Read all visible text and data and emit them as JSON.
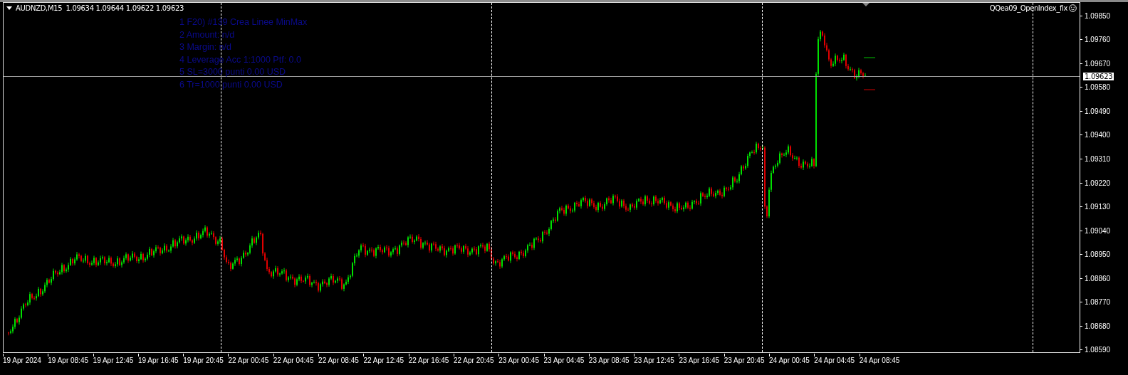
{
  "chart_header": {
    "symbol": "AUDNZD,M15",
    "ohlc": "1.09634 1.09644 1.09622 1.09623"
  },
  "indicator_lines": [
    "1 F20) #139 Crea Linee MinMax",
    "2 Amount: n/d",
    "3 Margin: n/d",
    "4 Leverage Acc 1:1000 Ptf: 0.0",
    "5 SL=3000 punti 0.00 USD",
    "6 Tr=1000 punti 0.00 USD"
  ],
  "expert_name": "QQea09_OpenIndex_fix",
  "current_price": "1.09623",
  "price_axis": [
    "1.09850",
    "1.09760",
    "1.09670",
    "1.09580",
    "1.09490",
    "1.09400",
    "1.09310",
    "1.09220",
    "1.09130",
    "1.09040",
    "1.08950",
    "1.08860",
    "1.08770",
    "1.08680",
    "1.08590"
  ],
  "time_axis": [
    "19 Apr 2024",
    "19 Apr 08:45",
    "19 Apr 12:45",
    "19 Apr 16:45",
    "19 Apr 20:45",
    "22 Apr 00:45",
    "22 Apr 04:45",
    "22 Apr 08:45",
    "22 Apr 12:45",
    "22 Apr 16:45",
    "22 Apr 20:45",
    "23 Apr 00:45",
    "23 Apr 04:45",
    "23 Apr 08:45",
    "23 Apr 12:45",
    "23 Apr 16:45",
    "23 Apr 20:45",
    "24 Apr 00:45",
    "24 Apr 04:45",
    "24 Apr 08:45"
  ]
}
